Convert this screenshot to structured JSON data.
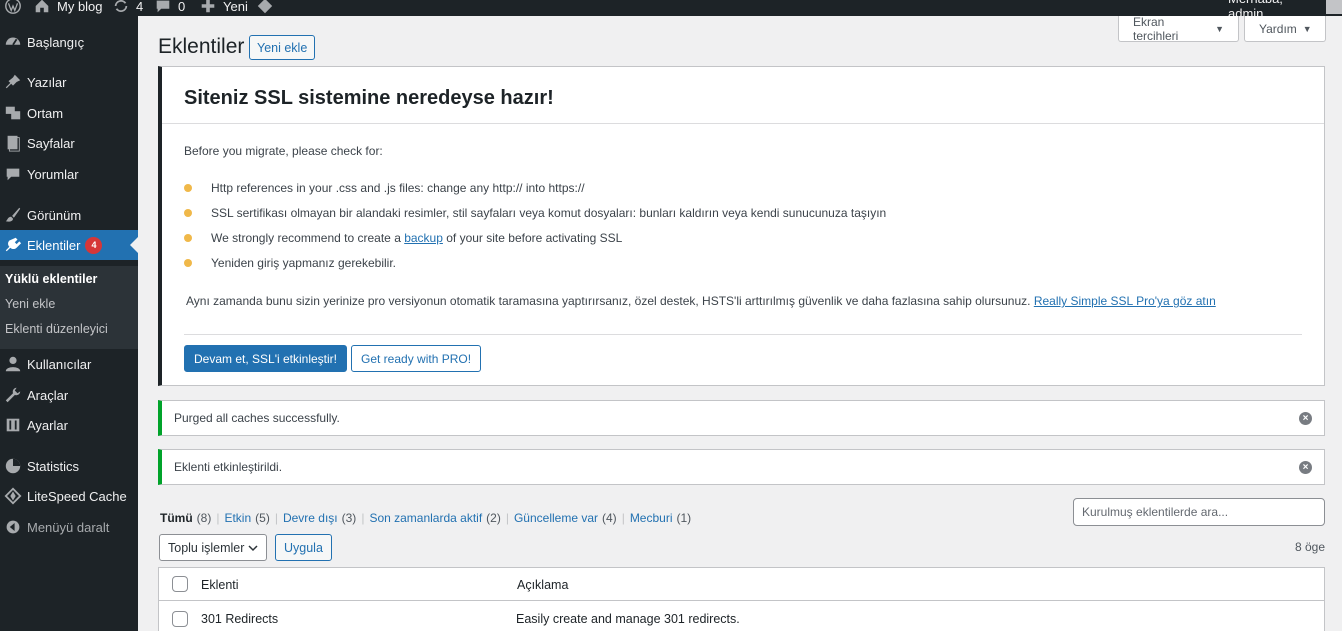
{
  "adminbar": {
    "site_name": "My blog",
    "updates_count": "4",
    "comments_count": "0",
    "new_label": "Yeni",
    "greeting": "Merhaba, admin"
  },
  "sidebar": {
    "items": [
      {
        "label": "Başlangıç",
        "icon": "dashboard-icon"
      },
      {
        "label": "Yazılar",
        "icon": "pin-icon"
      },
      {
        "label": "Ortam",
        "icon": "media-icon"
      },
      {
        "label": "Sayfalar",
        "icon": "page-icon"
      },
      {
        "label": "Yorumlar",
        "icon": "comment-icon"
      },
      {
        "label": "Görünüm",
        "icon": "brush-icon"
      },
      {
        "label": "Eklentiler",
        "icon": "plugin-icon",
        "badge": "4"
      },
      {
        "label": "Kullanıcılar",
        "icon": "users-icon"
      },
      {
        "label": "Araçlar",
        "icon": "wrench-icon"
      },
      {
        "label": "Ayarlar",
        "icon": "settings-icon"
      },
      {
        "label": "Statistics",
        "icon": "chart-pie-icon"
      },
      {
        "label": "LiteSpeed Cache",
        "icon": "litespeed-icon"
      },
      {
        "label": "Menüyü daralt",
        "icon": "collapse-icon"
      }
    ],
    "submenu": [
      {
        "label": "Yüklü eklentiler"
      },
      {
        "label": "Yeni ekle"
      },
      {
        "label": "Eklenti düzenleyici"
      }
    ]
  },
  "header": {
    "screen_options": "Ekran tercihleri",
    "help": "Yardım",
    "title": "Eklentiler",
    "add_new": "Yeni ekle"
  },
  "ssl_notice": {
    "title": "Siteniz SSL sistemine neredeyse hazır!",
    "intro": "Before you migrate, please check for:",
    "bullets": [
      {
        "text": "Http references in your .css and .js files: change any http:// into https://"
      },
      {
        "text": "SSL sertifikası olmayan bir alandaki resimler, stil sayfaları veya komut dosyaları: bunları kaldırın veya kendi sunucunuza taşıyın"
      },
      {
        "before": "We strongly recommend to create a ",
        "link": "backup",
        "after": " of your site before activating SSL"
      },
      {
        "text": "Yeniden giriş yapmanız gerekebilir."
      }
    ],
    "pro_text": "Aynı zamanda bunu sizin yerinize pro versiyonun otomatik taramasına yaptırırsanız, özel destek, HSTS'li arttırılmış güvenlik ve daha fazlasına sahip olursunuz. ",
    "pro_link": "Really Simple SSL Pro'ya göz atın",
    "btn_activate": "Devam et, SSL'i etkinleştir!",
    "btn_pro": "Get ready with PRO!",
    "bullet_color": "#f0b849"
  },
  "notices": [
    {
      "text": "Purged all caches successfully."
    },
    {
      "text": "Eklenti etkinleştirildi."
    }
  ],
  "filters": [
    {
      "label": "Tümü",
      "count": "(8)"
    },
    {
      "label": "Etkin",
      "count": "(5)"
    },
    {
      "label": "Devre dışı",
      "count": "(3)"
    },
    {
      "label": "Son zamanlarda aktif",
      "count": "(2)"
    },
    {
      "label": "Güncelleme var",
      "count": "(4)"
    },
    {
      "label": "Mecburi",
      "count": "(1)"
    }
  ],
  "search": {
    "placeholder": "Kurulmuş eklentilerde ara..."
  },
  "bulk": {
    "selected": "Toplu işlemler",
    "apply": "Uygula"
  },
  "item_count": "8 öge",
  "table": {
    "columns": [
      "Eklenti",
      "Açıklama"
    ],
    "rows": [
      {
        "name": "301 Redirects",
        "description": "Easily create and manage 301 redirects."
      }
    ]
  },
  "colors": {
    "accent": "#2271b1",
    "sidebar_bg": "#1d2327",
    "success": "#00a32a",
    "badge": "#d63638"
  }
}
